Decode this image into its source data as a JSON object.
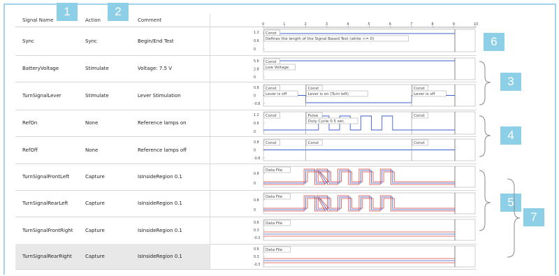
{
  "columns": {
    "signal_name": "Signal Name",
    "action": "Action",
    "comment": "Comment"
  },
  "rows": [
    {
      "name": "Sync",
      "action": "Sync",
      "comment": "Begin/End Test"
    },
    {
      "name": "BatteryVoltage",
      "action": "Stimulate",
      "comment": "Voltage: 7.5 V"
    },
    {
      "name": "TurnSignalLever",
      "action": "Stimulate",
      "comment": "Lever Stimulation"
    },
    {
      "name": "RefOn",
      "action": "None",
      "comment": "Reference lamps on"
    },
    {
      "name": "RefOff",
      "action": "None",
      "comment": "Reference lamps off"
    },
    {
      "name": "TurnSignalFrontLeft",
      "action": "Capture",
      "comment": "IsInsideRegion 0.1"
    },
    {
      "name": "TurnSignalRearLeft",
      "action": "Capture",
      "comment": "IsInsideRegion 0.1"
    },
    {
      "name": "TurnSignalFrontRight",
      "action": "Capture",
      "comment": "IsInsideRegion 0.1"
    },
    {
      "name": "TurnSignalRearRight",
      "action": "Capture",
      "comment": "IsInsideRegion 0.1"
    }
  ],
  "time_axis": {
    "ticks": [
      "0",
      "1",
      "2",
      "3",
      "4",
      "5",
      "6",
      "7",
      "8",
      "9",
      "10"
    ]
  },
  "badges": [
    "1",
    "2",
    "3",
    "4",
    "5",
    "6",
    "7"
  ],
  "plots": [
    {
      "yticks": [
        "1.2",
        "0.6",
        "0"
      ],
      "segments": [
        {
          "label": "Const",
          "note": "Defines the length of the Signal Based Test (while <= 0)"
        }
      ]
    },
    {
      "yticks": [
        "5.6",
        "2.8",
        "0"
      ],
      "segments": [
        {
          "label": "Const",
          "note": "Low Voltage"
        }
      ]
    },
    {
      "yticks": [
        "0.8",
        "0",
        "-0.8"
      ],
      "segments": [
        {
          "label": "Const",
          "note": "Lever is off"
        },
        {
          "label": "Const",
          "note": "Lever is on (Turn left)"
        },
        {
          "label": "Const",
          "note": "Lever is off"
        }
      ]
    },
    {
      "yticks": [
        "1.2",
        "0.6",
        "0"
      ],
      "segments": [
        {
          "label": "Const",
          "note": ""
        },
        {
          "label": "Pulse",
          "note": "Duty Cycle 0.5 sec."
        },
        {
          "label": "Const",
          "note": ""
        }
      ]
    },
    {
      "yticks": [
        "0.8",
        "0",
        "-0.8"
      ],
      "segments": [
        {
          "label": "Const",
          "note": ""
        },
        {
          "label": "Const",
          "note": ""
        },
        {
          "label": "Const",
          "note": ""
        }
      ]
    },
    {
      "yticks": [
        "0.8",
        "0"
      ],
      "segments": [
        {
          "label": "Data File",
          "note": ""
        }
      ]
    },
    {
      "yticks": [
        "0.8",
        "0"
      ],
      "segments": [
        {
          "label": "Data File",
          "note": ""
        }
      ]
    },
    {
      "yticks": [
        "0.6",
        "0.3",
        "-0.3"
      ],
      "segments": [
        {
          "label": "Data File",
          "note": ""
        }
      ]
    },
    {
      "yticks": [
        "0.6",
        "0.3",
        "-0.3"
      ],
      "segments": [
        {
          "label": "Data File",
          "note": ""
        }
      ]
    }
  ],
  "colors": {
    "signal": "#3a5fcd",
    "capture": "#d9463c",
    "accent": "#8ecfe8",
    "grid": "#d6d6d6"
  }
}
